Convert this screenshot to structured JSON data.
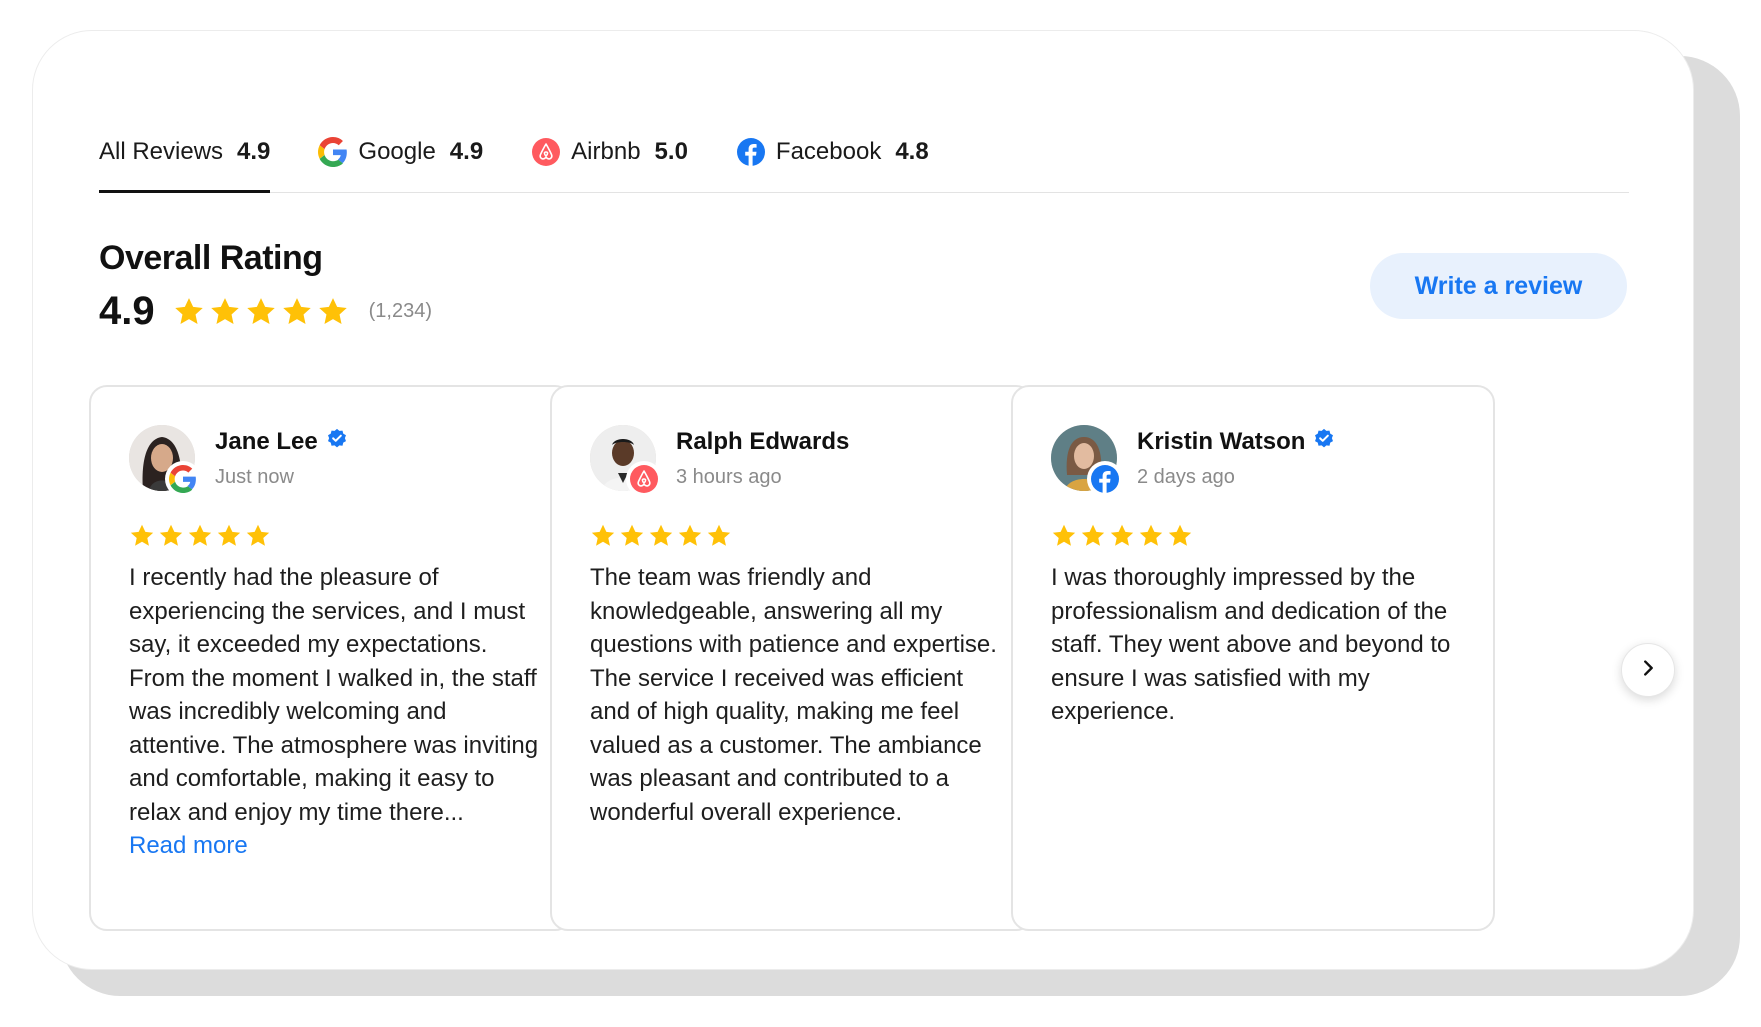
{
  "tabs": [
    {
      "label": "All Reviews",
      "score": "4.9",
      "icon": "none"
    },
    {
      "label": "Google",
      "score": "4.9",
      "icon": "google-icon"
    },
    {
      "label": "Airbnb",
      "score": "5.0",
      "icon": "airbnb-icon"
    },
    {
      "label": "Facebook",
      "score": "4.8",
      "icon": "facebook-icon"
    }
  ],
  "overall": {
    "title": "Overall Rating",
    "value": "4.9",
    "stars": 5,
    "count": "(1,234)"
  },
  "write_review_label": "Write a review",
  "reviews": [
    {
      "name": "Jane Lee",
      "verified": true,
      "time": "Just now",
      "source": "google-icon",
      "stars": 5,
      "text": "I recently had the pleasure of experiencing the services, and I must say, it exceeded my expectations. From the moment I walked in, the staff was incredibly welcoming and attentive. The atmosphere was inviting and comfortable, making it easy to relax and enjoy my time there...",
      "read_more": "Read more"
    },
    {
      "name": "Ralph Edwards",
      "verified": false,
      "time": "3 hours ago",
      "source": "airbnb-icon",
      "stars": 5,
      "text": "The team was friendly and knowledgeable, answering all my questions with patience and expertise. The service I received was efficient and of high quality, making me feel valued as a customer. The ambiance was pleasant and contributed to a wonderful overall experience."
    },
    {
      "name": "Kristin Watson",
      "verified": true,
      "time": "2 days ago",
      "source": "facebook-icon",
      "stars": 5,
      "text": "I was thoroughly impressed by the professionalism and dedication of the staff. They went above and beyond to ensure I was satisfied with my experience."
    }
  ],
  "colors": {
    "star": "#FFC107",
    "accent": "#1877F2",
    "button_bg": "#E8F1FD",
    "airbnb": "#FF5A5F",
    "verified": "#1877F2"
  }
}
